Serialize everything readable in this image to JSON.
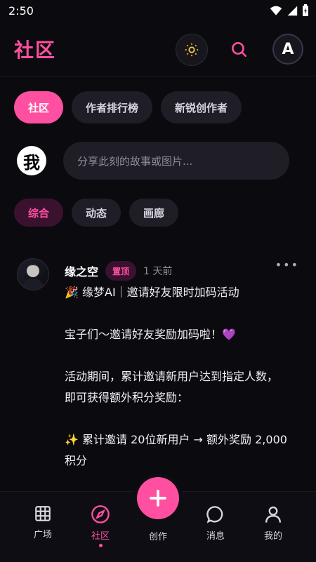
{
  "status": {
    "time": "2:50"
  },
  "header": {
    "title": "社区",
    "avatar_letter": "A"
  },
  "tabs": [
    {
      "label": "社区",
      "active": true
    },
    {
      "label": "作者排行榜",
      "active": false
    },
    {
      "label": "新锐创作者",
      "active": false
    }
  ],
  "composer": {
    "avatar_text": "我",
    "placeholder": "分享此刻的故事或图片..."
  },
  "filters": [
    {
      "label": "综合",
      "active": true
    },
    {
      "label": "动态",
      "active": false
    },
    {
      "label": "画廊",
      "active": false
    }
  ],
  "post": {
    "username": "缘之空",
    "badge": "置顶",
    "time_ago": "1 天前",
    "lines": [
      "🎉 缘梦AI｜邀请好友限时加码活动",
      "",
      "宝子们～邀请好友奖励加码啦！💜",
      "",
      "活动期间，累计邀请新用户达到指定人数，",
      "即可获得额外积分奖励：",
      "",
      "✨ 累计邀请 20位新用户 → 额外奖励 2,000",
      "积分"
    ]
  },
  "bottom_nav": {
    "items": [
      {
        "label": "广场"
      },
      {
        "label": "社区"
      },
      {
        "label": "创作"
      },
      {
        "label": "消息"
      },
      {
        "label": "我的"
      }
    ]
  },
  "colors": {
    "accent": "#ff4fa0",
    "background": "#0b0a0f",
    "pill": "#1f1e26"
  }
}
